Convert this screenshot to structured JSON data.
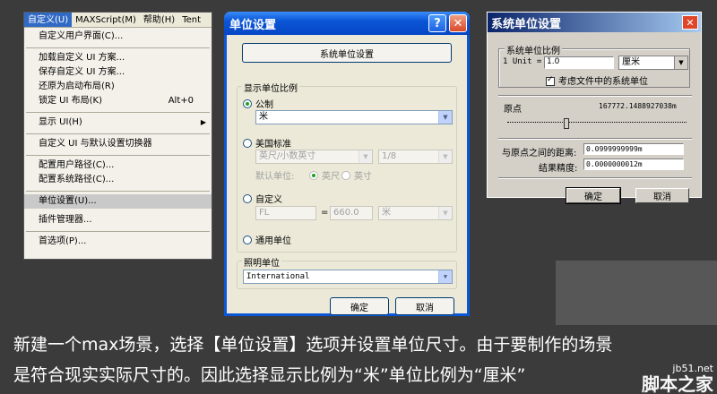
{
  "menu": {
    "bar": [
      "自定义(U)",
      "MAXScript(M)",
      "帮助(H)",
      "Tent"
    ],
    "items": [
      {
        "label": "自定义用户界面(C)..."
      },
      {
        "label": "加载自定义 UI 方案..."
      },
      {
        "label": "保存自定义 UI 方案..."
      },
      {
        "label": "还原为启动布局(R)"
      },
      {
        "label": "锁定 UI 布局(K)",
        "shortcut": "Alt+0"
      },
      {
        "label": "显示 UI(H)"
      },
      {
        "label": "自定义 UI 与默认设置切换器"
      },
      {
        "label": "配置用户路径(C)..."
      },
      {
        "label": "配置系统路径(C)..."
      },
      {
        "label": "单位设置(U)..."
      },
      {
        "label": "插件管理器..."
      },
      {
        "label": "首选项(P)..."
      }
    ]
  },
  "units_dialog": {
    "title": "单位设置",
    "help_button": "?",
    "close_button": "✕",
    "system_units_button": "系统单位设置",
    "display_group": "显示单位比例",
    "metric_label": "公制",
    "metric_value": "米",
    "us_label": "美国标准",
    "us_value": "英尺/小数英寸",
    "us_fraction": "1/8",
    "default_units_label": "默认单位:",
    "feet_label": "英尺",
    "inches_label": "英寸",
    "custom_label": "自定义",
    "custom_name": "FL",
    "custom_equals": "=",
    "custom_value": "660.0",
    "custom_unit": "米",
    "generic_label": "通用单位",
    "lighting_group": "照明单位",
    "lighting_value": "International",
    "ok": "确定",
    "cancel": "取消"
  },
  "system_dialog": {
    "title": "系统单位设置",
    "close_button": "✕",
    "scale_group": "系统单位比例",
    "unit_label": "1 Unit =",
    "unit_value": "1.0",
    "unit_type": "厘米",
    "respect_label": "考虑文件中的系统单位",
    "origin_label": "原点",
    "origin_value": "167772.1488927038m",
    "distance_label": "与原点之间的距离:",
    "distance_value": "0.0999999999m",
    "precision_label": "结果精度:",
    "precision_value": "0.0000000012m",
    "ok": "确定",
    "cancel": "取消"
  },
  "caption": {
    "line1": "新建一个max场景，选择【单位设置】选项并设置单位尺寸。由于要制作的场景",
    "line2": "是符合现实实际尺寸的。因此选择显示比例为“米”单位比例为“厘米”",
    "watermark_url": "jb51.net",
    "watermark_name": "脚本之家"
  }
}
